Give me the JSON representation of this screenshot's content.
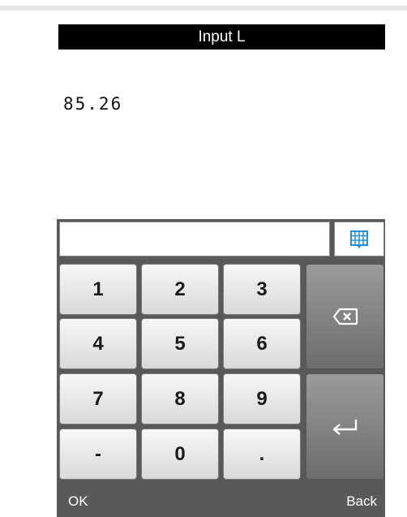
{
  "title": "Input L",
  "value": "85.26",
  "input": {
    "value": ""
  },
  "keypad": {
    "keys": [
      "1",
      "2",
      "3",
      "4",
      "5",
      "6",
      "7",
      "8",
      "9",
      "-",
      "0",
      "."
    ]
  },
  "icons": {
    "keyboard_toggle": "keyboard-grid-icon",
    "backspace": "backspace-icon",
    "enter": "enter-icon"
  },
  "softkeys": {
    "ok": "OK",
    "back": "Back"
  },
  "colors": {
    "title_bar": "#000000",
    "keypad_bg": "#595959",
    "toggle_icon": "#1e90d8"
  }
}
